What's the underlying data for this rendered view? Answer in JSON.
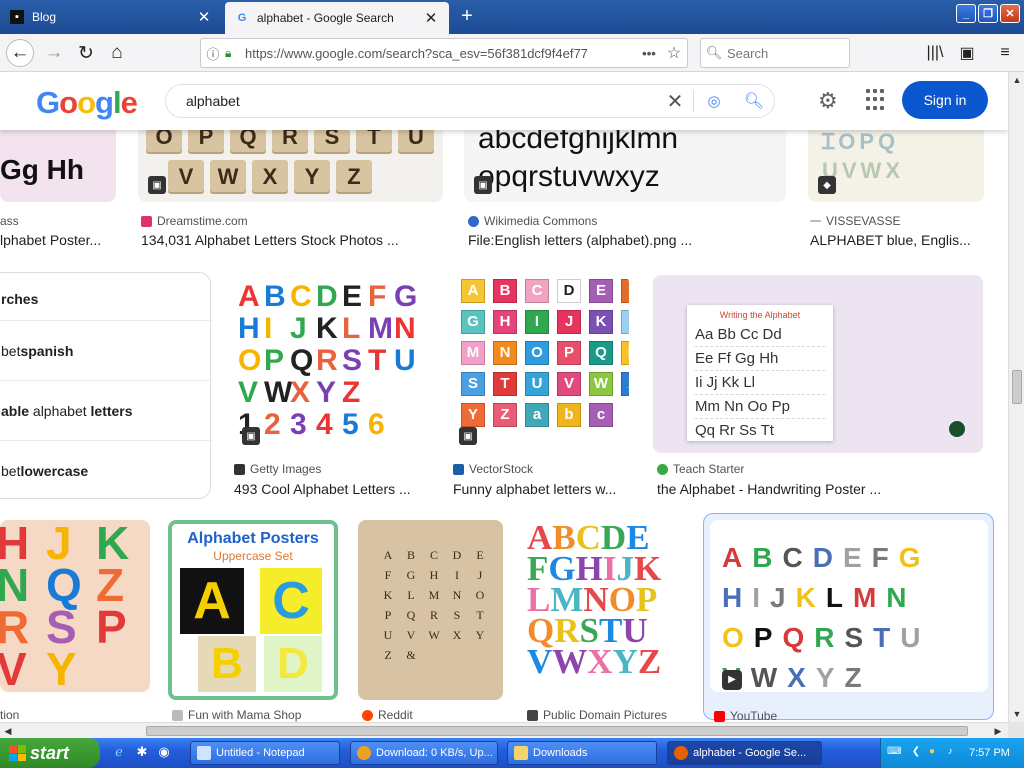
{
  "browser": {
    "tabs": [
      {
        "label": "Blog",
        "active": false
      },
      {
        "label": "alphabet - Google Search",
        "active": true
      }
    ],
    "new_tab_icon": "plus-icon",
    "url": "https://www.google.com/search?sca_esv=56f381dcf9f4ef77",
    "search_placeholder": "Search"
  },
  "google": {
    "logo": [
      "G",
      "o",
      "o",
      "g",
      "l",
      "e"
    ],
    "query": "alphabet",
    "signin_label": "Sign in"
  },
  "row1": [
    {
      "source": "",
      "title": "lphabet Poster...",
      "source_partial": "ass",
      "caption_in_image": "Gg Hh"
    },
    {
      "source": "Dreamstime.com",
      "title": "134,031 Alphabet Letters Stock Photos ...",
      "letters_top": [
        "O",
        "P",
        "Q",
        "R",
        "S",
        "T",
        "U"
      ],
      "letters_bottom": [
        "V",
        "W",
        "X",
        "Y",
        "Z"
      ]
    },
    {
      "source": "Wikimedia Commons",
      "title": "File:English letters (alphabet).png ...",
      "line1": "abcdefghijklmn",
      "line2": "opqrstuvwxyz"
    },
    {
      "source": "VISSEVASSE",
      "title": "ALPHABET blue, Englis..."
    }
  ],
  "related": {
    "heading": "rches",
    "items": [
      {
        "pre": "bet ",
        "bold": "spanish",
        "post": ""
      },
      {
        "pre": "",
        "bold": "able",
        "post": " alphabet ",
        "bold2": "letters"
      },
      {
        "pre": "bet ",
        "bold": "lowercase",
        "post": ""
      }
    ]
  },
  "row2": [
    {
      "source": "Getty Images",
      "title": "493 Cool Alphabet Letters ...",
      "rows": [
        "ABCDEFG",
        "HIJKLMN",
        "OPQRSTU",
        "VWXYZ",
        "123456"
      ]
    },
    {
      "source": "VectorStock",
      "title": "Funny alphabet letters w...",
      "letters": [
        "A",
        "B",
        "C",
        "D",
        "E",
        "F",
        "G",
        "H",
        "I",
        "J",
        "K",
        "L",
        "M",
        "N",
        "O",
        "P",
        "Q",
        "R",
        "S",
        "T",
        "U",
        "V",
        "W",
        "X",
        "Y",
        "Z",
        "a",
        "b",
        "c"
      ]
    },
    {
      "source": "Teach Starter",
      "title": "the Alphabet - Handwriting Poster ...",
      "poster_title": "Writing the Alphabet",
      "lines": [
        "Aa Bb Cc Dd",
        "Ee Ff Gg Hh",
        "Ii Jj Kk Ll",
        "Mm Nn Oo Pp",
        "Qq Rr Ss Tt"
      ]
    }
  ],
  "row3": [
    {
      "source": "",
      "source_partial": "tion"
    },
    {
      "source": "Fun with Mama Shop",
      "poster_title": "Alphabet Posters",
      "poster_sub": "Uppercase Set",
      "letters": [
        "A",
        "C",
        "B",
        "D"
      ]
    },
    {
      "source": "Reddit",
      "letters": [
        "A",
        "B",
        "C",
        "D",
        "E",
        "F",
        "G",
        "H",
        "I",
        "J",
        "K",
        "L",
        "M",
        "N",
        "O",
        "P",
        "Q",
        "R",
        "S",
        "T",
        "U",
        "V",
        "W",
        "X",
        "Y",
        "Z",
        "&"
      ]
    },
    {
      "source": "Public Domain Pictures",
      "rows": [
        "ABCDE",
        "FGHIJK",
        "LMNOP",
        "QRSTU",
        "VWXYZ"
      ]
    },
    {
      "source": "YouTube",
      "rows": [
        "ABCDEFG",
        "HIJKLMN",
        "OPQRSTU",
        "VWXYZ"
      ]
    }
  ],
  "taskbar": {
    "start_label": "start",
    "tasks": [
      {
        "label": "Untitled - Notepad",
        "active": false
      },
      {
        "label": "Download: 0 KB/s, Up...",
        "active": false
      },
      {
        "label": "Downloads",
        "active": false
      },
      {
        "label": "alphabet - Google Se...",
        "active": true
      }
    ],
    "clock": "7:57 PM"
  },
  "colors": {
    "accent": "#0b57d0",
    "titlebar": "#1c4b94",
    "taskbar": "#245edb",
    "start": "#2f8a26"
  }
}
